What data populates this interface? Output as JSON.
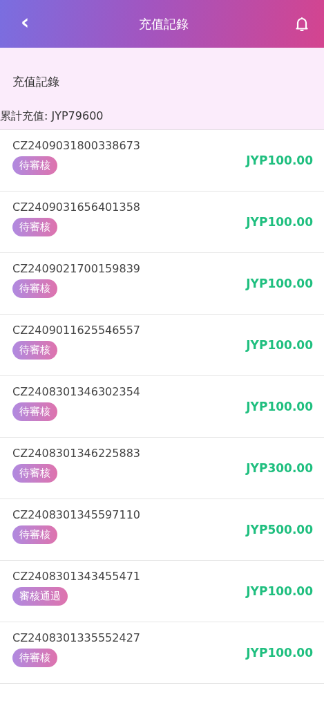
{
  "header": {
    "back": "‹",
    "title": "充值記錄"
  },
  "summary": {
    "heading": "充值記錄",
    "total": "累計充值: JYP79600"
  },
  "records": [
    {
      "order": "CZ2409031800338673",
      "status": "待審核",
      "amount": "JYP100.00"
    },
    {
      "order": "CZ2409031656401358",
      "status": "待審核",
      "amount": "JYP100.00"
    },
    {
      "order": "CZ2409021700159839",
      "status": "待審核",
      "amount": "JYP100.00"
    },
    {
      "order": "CZ2409011625546557",
      "status": "待審核",
      "amount": "JYP100.00"
    },
    {
      "order": "CZ2408301346302354",
      "status": "待審核",
      "amount": "JYP100.00"
    },
    {
      "order": "CZ2408301346225883",
      "status": "待審核",
      "amount": "JYP300.00"
    },
    {
      "order": "CZ2408301345597110",
      "status": "待審核",
      "amount": "JYP500.00"
    },
    {
      "order": "CZ2408301343455471",
      "status": "審核通過",
      "amount": "JYP100.00"
    },
    {
      "order": "CZ2408301335552427",
      "status": "待審核",
      "amount": "JYP100.00"
    }
  ]
}
